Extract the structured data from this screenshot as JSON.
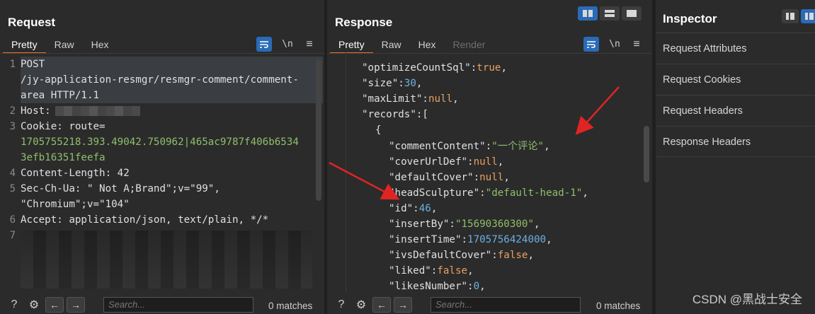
{
  "request": {
    "title": "Request",
    "tabs": [
      "Pretty",
      "Raw",
      "Hex"
    ],
    "active_tab": "Pretty",
    "lines": [
      {
        "n": "1",
        "text": "POST"
      },
      {
        "n": "",
        "text": "/jy-application-resmgr/resmgr-comment/comment-"
      },
      {
        "n": "",
        "text": "area HTTP/1.1"
      },
      {
        "n": "2",
        "key": "Host:",
        "text": ""
      },
      {
        "n": "3",
        "key": "Cookie:",
        "text": " route="
      },
      {
        "n": "",
        "text": "1705755218.393.49042.750962|465ac9787f406b6534"
      },
      {
        "n": "",
        "text": "3efb16351feefa"
      },
      {
        "n": "4",
        "key": "Content-Length:",
        "text": " 42"
      },
      {
        "n": "5",
        "key": "Sec-Ch-Ua:",
        "text": " \" Not A;Brand\";v=\"99\","
      },
      {
        "n": "",
        "text": "\"Chromium\";v=\"104\""
      },
      {
        "n": "6",
        "key": "Accept:",
        "text": " application/json, text/plain, */*"
      },
      {
        "n": "7",
        "text": ""
      }
    ],
    "search_placeholder": "Search...",
    "matches": "0 matches"
  },
  "response": {
    "title": "Response",
    "tabs": [
      "Pretty",
      "Raw",
      "Hex",
      "Render"
    ],
    "active_tab": "Pretty",
    "lines": [
      {
        "indent": 1,
        "key": "\"optimizeCountSql\"",
        "sep": ":",
        "val": "true",
        "vclass": "val-orange",
        "tail": ","
      },
      {
        "indent": 1,
        "key": "\"size\"",
        "sep": ":",
        "val": "30",
        "vclass": "val-blue",
        "tail": ","
      },
      {
        "indent": 1,
        "key": "\"maxLimit\"",
        "sep": ":",
        "val": "null",
        "vclass": "val-orange",
        "tail": ","
      },
      {
        "indent": 1,
        "key": "\"records\"",
        "sep": ":",
        "val": "[",
        "vclass": "val-white",
        "tail": ""
      },
      {
        "indent": 2,
        "key": "",
        "sep": "",
        "val": "{",
        "vclass": "val-white",
        "tail": ""
      },
      {
        "indent": 3,
        "key": "\"commentContent\"",
        "sep": ":",
        "val": "\"一个评论\"",
        "vclass": "val-green",
        "tail": ","
      },
      {
        "indent": 3,
        "key": "\"coverUrlDef\"",
        "sep": ":",
        "val": "null",
        "vclass": "val-orange",
        "tail": ","
      },
      {
        "indent": 3,
        "key": "\"defaultCover\"",
        "sep": ":",
        "val": "null",
        "vclass": "val-orange",
        "tail": ","
      },
      {
        "indent": 3,
        "key": "\"headSculpture\"",
        "sep": ":",
        "val": "\"default-head-1\"",
        "vclass": "val-green",
        "tail": ","
      },
      {
        "indent": 3,
        "key": "\"id\"",
        "sep": ":",
        "val": "46",
        "vclass": "val-blue",
        "tail": ","
      },
      {
        "indent": 3,
        "key": "\"insertBy\"",
        "sep": ":",
        "val": "\"15690360300\"",
        "vclass": "val-green",
        "tail": ","
      },
      {
        "indent": 3,
        "key": "\"insertTime\"",
        "sep": ":",
        "val": "1705756424000",
        "vclass": "val-blue",
        "tail": ","
      },
      {
        "indent": 3,
        "key": "\"ivsDefaultCover\"",
        "sep": ":",
        "val": "false",
        "vclass": "val-orange",
        "tail": ","
      },
      {
        "indent": 3,
        "key": "\"liked\"",
        "sep": ":",
        "val": "false",
        "vclass": "val-orange",
        "tail": ","
      },
      {
        "indent": 3,
        "key": "\"likesNumber\"",
        "sep": ":",
        "val": "0",
        "vclass": "val-blue",
        "tail": ","
      }
    ],
    "search_placeholder": "Search...",
    "matches": "0 matches"
  },
  "inspector": {
    "title": "Inspector",
    "items": [
      "Request Attributes",
      "Request Cookies",
      "Request Headers",
      "Response Headers"
    ]
  },
  "toolbar": {
    "newline_label": "\\n",
    "menu_label": "≡"
  },
  "watermark": "CSDN @黑战士安全",
  "colors": {
    "accent": "#e8732a",
    "button_blue": "#2a6bb8",
    "arrow": "#e02424"
  }
}
